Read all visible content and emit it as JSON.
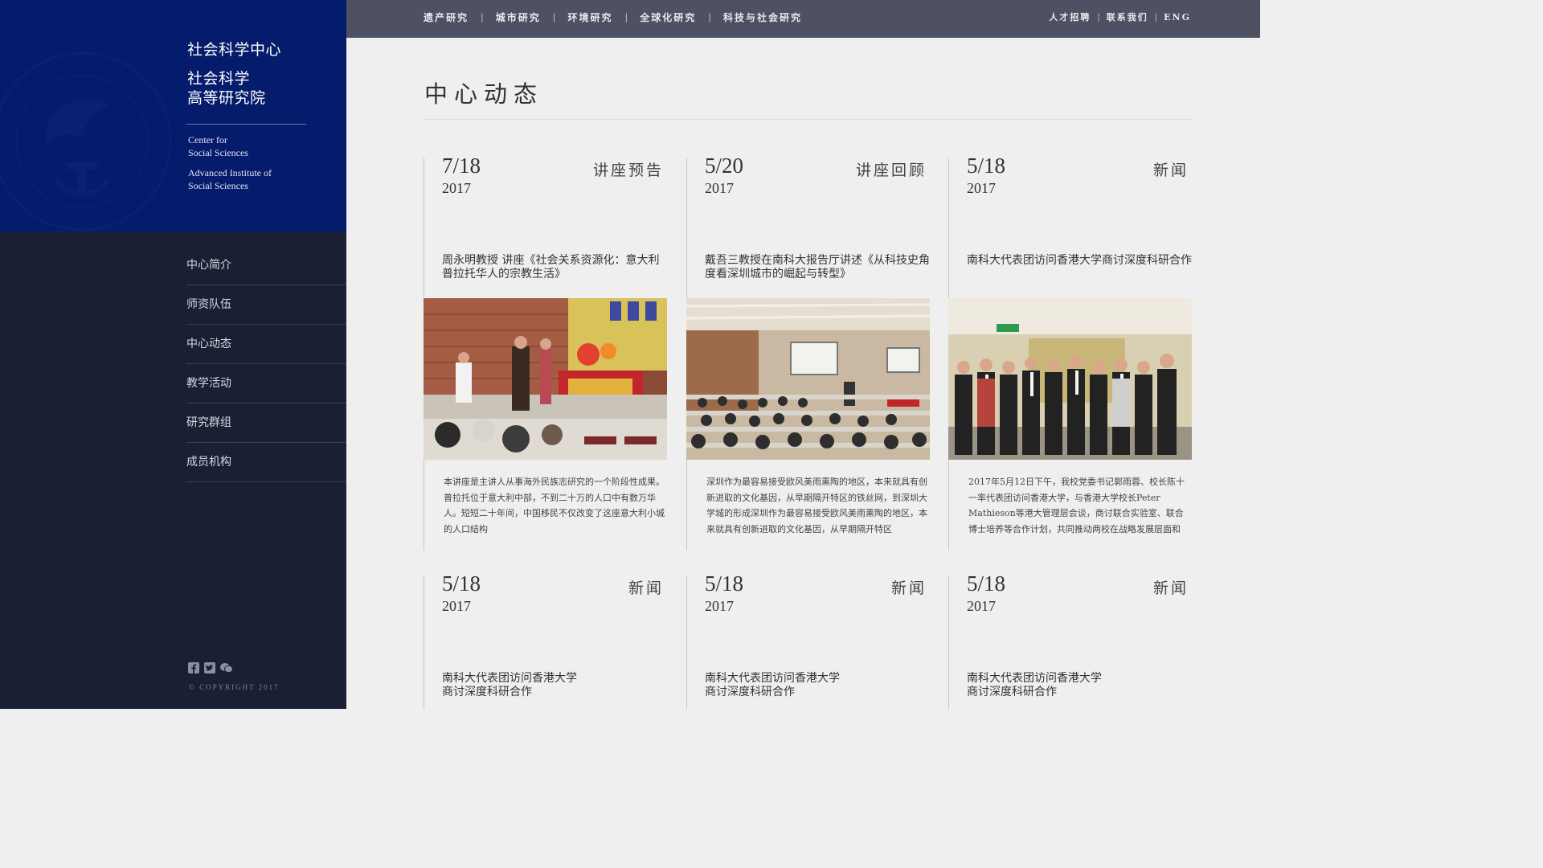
{
  "brand": {
    "cn_line1": "社会科学中心",
    "cn_line2": "社会科学",
    "cn_line3": "高等研究院",
    "en_line1": "Center for",
    "en_line2": "Social Sciences",
    "en_line3": "Advanced Institute of",
    "en_line4": "Social Sciences",
    "seal_color": "#0b2776"
  },
  "sidebar": {
    "items": [
      {
        "label": "中心简介"
      },
      {
        "label": "师资队伍"
      },
      {
        "label": "中心动态"
      },
      {
        "label": "教学活动"
      },
      {
        "label": "研究群组"
      },
      {
        "label": "成员机构"
      }
    ],
    "social_icons": [
      "facebook-icon",
      "twitter-icon",
      "wechat-icon"
    ],
    "copyright": "© COPYRIGHT 2017"
  },
  "topnav": {
    "items": [
      {
        "label": "遗产研究"
      },
      {
        "label": "城市研究"
      },
      {
        "label": "环境研究"
      },
      {
        "label": "全球化研究"
      },
      {
        "label": "科技与社会研究"
      }
    ],
    "separator": "|",
    "util": [
      {
        "label": "人才招聘"
      },
      {
        "label": "联系我们"
      },
      {
        "label": "ENG"
      }
    ]
  },
  "main": {
    "title": "中心动态",
    "cards": [
      {
        "date": "7/18",
        "year": "2017",
        "category": "讲座预告",
        "headline": "周永明教授 讲座《社会关系资源化：意大利普拉托华人的宗教生活》",
        "summary": "本讲座是主讲人从事海外民族志研究的一个阶段性成果。普拉托位于意大利中部，不到二十万的人口中有数万华人。短短二十年间，中国移民不仅改变了这座意大利小城的人口结构"
      },
      {
        "date": "5/20",
        "year": "2017",
        "category": "讲座回顾",
        "headline": "戴吾三教授在南科大报告厅讲述《从科技史角度看深圳城市的崛起与转型》",
        "summary": "深圳作为最容易接受欧风美雨熏陶的地区，本来就具有创新进取的文化基因，从早期隔开特区的铁丝网，到深圳大学城的形成深圳作为最容易接受欧风美雨熏陶的地区，本来就具有创新进取的文化基因，从早期隔开特区"
      },
      {
        "date": "5/18",
        "year": "2017",
        "category": "新闻",
        "headline": "南科大代表团访问香港大学商讨深度科研合作",
        "summary": "2017年5月12日下午，我校党委书记郭雨蓉、校长陈十一率代表团访问香港大学，与香港大学校长Peter Mathieson等港大管理层会谈，商讨联合实验室、联合博士培养等合作计划，共同推动两校在战略发展层面和"
      },
      {
        "date": "5/18",
        "year": "2017",
        "category": "新闻",
        "headline": "南科大代表团访问香港大学商讨深度科研合作"
      },
      {
        "date": "5/18",
        "year": "2017",
        "category": "新闻",
        "headline": "南科大代表团访问香港大学商讨深度科研合作"
      },
      {
        "date": "5/18",
        "year": "2017",
        "category": "新闻",
        "headline": "南科大代表团访问香港大学商讨深度科研合作"
      }
    ]
  }
}
